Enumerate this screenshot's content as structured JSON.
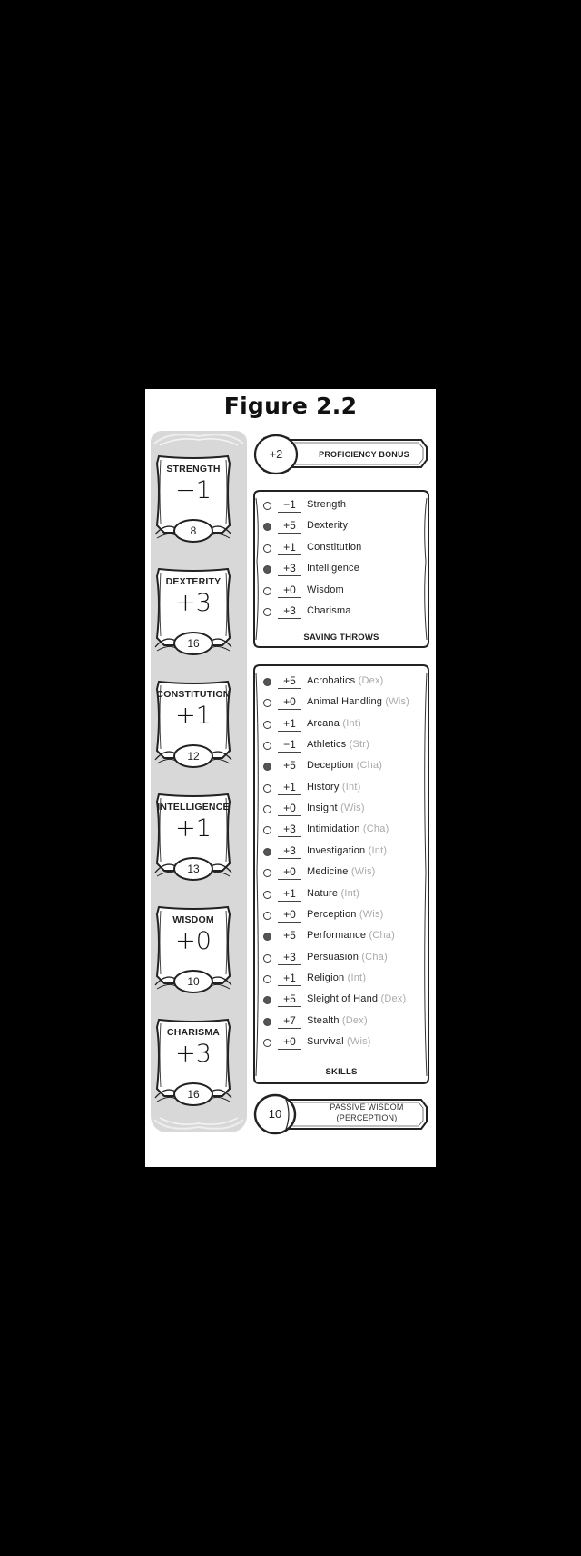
{
  "figure": {
    "title": "Figure 2.2"
  },
  "abilities": [
    {
      "name": "STRENGTH",
      "modifier": "−1",
      "score": "8"
    },
    {
      "name": "DEXTERITY",
      "modifier": "+3",
      "score": "16"
    },
    {
      "name": "CONSTITUTION",
      "modifier": "+1",
      "score": "12"
    },
    {
      "name": "INTELLIGENCE",
      "modifier": "+1",
      "score": "13"
    },
    {
      "name": "WISDOM",
      "modifier": "+0",
      "score": "10"
    },
    {
      "name": "CHARISMA",
      "modifier": "+3",
      "score": "16"
    }
  ],
  "proficiency": {
    "value": "+2",
    "label": "PROFICIENCY BONUS"
  },
  "saving_throws": {
    "caption": "SAVING THROWS",
    "items": [
      {
        "bonus": "−1",
        "label": "Strength",
        "proficient": false
      },
      {
        "bonus": "+5",
        "label": "Dexterity",
        "proficient": true
      },
      {
        "bonus": "+1",
        "label": "Constitution",
        "proficient": false
      },
      {
        "bonus": "+3",
        "label": "Intelligence",
        "proficient": true
      },
      {
        "bonus": "+0",
        "label": "Wisdom",
        "proficient": false
      },
      {
        "bonus": "+3",
        "label": "Charisma",
        "proficient": false
      }
    ]
  },
  "skills": {
    "caption": "SKILLS",
    "items": [
      {
        "bonus": "+5",
        "label": "Acrobatics",
        "ability": "(Dex)",
        "proficient": true
      },
      {
        "bonus": "+0",
        "label": "Animal Handling",
        "ability": "(Wis)",
        "proficient": false
      },
      {
        "bonus": "+1",
        "label": "Arcana",
        "ability": "(Int)",
        "proficient": false
      },
      {
        "bonus": "−1",
        "label": "Athletics",
        "ability": "(Str)",
        "proficient": false
      },
      {
        "bonus": "+5",
        "label": "Deception",
        "ability": "(Cha)",
        "proficient": true
      },
      {
        "bonus": "+1",
        "label": "History",
        "ability": "(Int)",
        "proficient": false
      },
      {
        "bonus": "+0",
        "label": "Insight",
        "ability": "(Wis)",
        "proficient": false
      },
      {
        "bonus": "+3",
        "label": "Intimidation",
        "ability": "(Cha)",
        "proficient": false
      },
      {
        "bonus": "+3",
        "label": "Investigation",
        "ability": "(Int)",
        "proficient": true
      },
      {
        "bonus": "+0",
        "label": "Medicine",
        "ability": "(Wis)",
        "proficient": false
      },
      {
        "bonus": "+1",
        "label": "Nature",
        "ability": "(Int)",
        "proficient": false
      },
      {
        "bonus": "+0",
        "label": "Perception",
        "ability": "(Wis)",
        "proficient": false
      },
      {
        "bonus": "+5",
        "label": "Performance",
        "ability": "(Cha)",
        "proficient": true
      },
      {
        "bonus": "+3",
        "label": "Persuasion",
        "ability": "(Cha)",
        "proficient": false
      },
      {
        "bonus": "+1",
        "label": "Religion",
        "ability": "(Int)",
        "proficient": false
      },
      {
        "bonus": "+5",
        "label": "Sleight of Hand",
        "ability": "(Dex)",
        "proficient": true
      },
      {
        "bonus": "+7",
        "label": "Stealth",
        "ability": "(Dex)",
        "proficient": true
      },
      {
        "bonus": "+0",
        "label": "Survival",
        "ability": "(Wis)",
        "proficient": false
      }
    ]
  },
  "passive": {
    "value": "10",
    "label_line1": "PASSIVE WISDOM",
    "label_line2": "(PERCEPTION)"
  }
}
